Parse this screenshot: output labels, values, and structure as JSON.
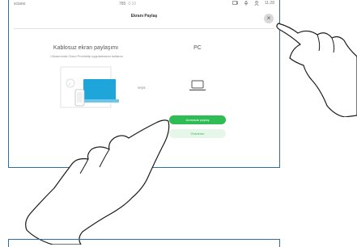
{
  "status_bar": {
    "left": "sciano",
    "center_number": "785",
    "center_muted": "0:10",
    "time": "11:28",
    "icons": [
      "screen-share-icon",
      "mic-icon",
      "person-icon"
    ]
  },
  "dialog": {
    "title": "Ekranı Paylaş",
    "close_icon": "close-icon",
    "wireless": {
      "title": "Kablosuz ekran paylaşımı",
      "description": "Cihazınızda Cisco Proximity uygulamasını kullanın"
    },
    "or_label": "veya",
    "pc": {
      "title": "PC"
    },
    "buttons": {
      "primary": "Aramada paylaş",
      "secondary": "Önizleme"
    }
  },
  "colors": {
    "accent_green": "#2fbc55",
    "frame_blue": "#2f6f9f",
    "illustration_blue": "#1ea5d9"
  }
}
